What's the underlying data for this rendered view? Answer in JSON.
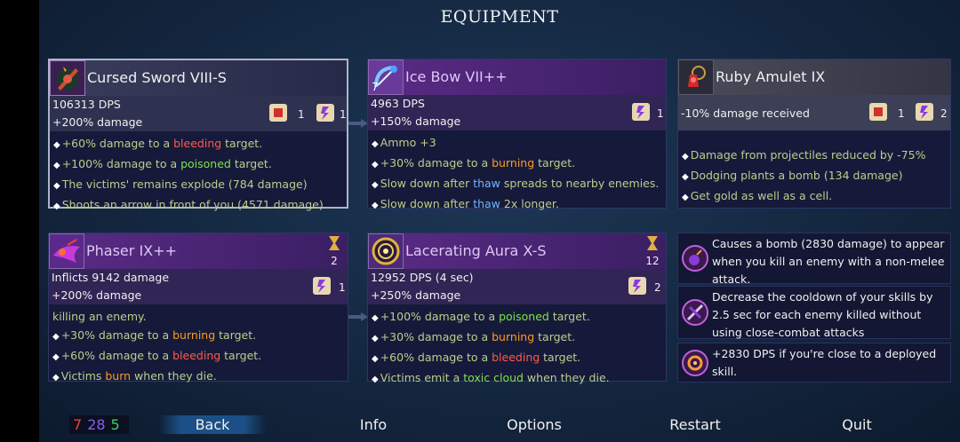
{
  "screen": {
    "title": "EQUIPMENT"
  },
  "cards": {
    "sword": {
      "name": "Cursed Sword VIII-S",
      "stat1": "106313 DPS",
      "stat2": "+200% damage",
      "scroll_a": "1",
      "scroll_b": "1",
      "lines": [
        [
          "+60% damage to a ",
          "bleeding",
          " target."
        ],
        [
          "+100% damage to a ",
          "poisoned",
          " target."
        ],
        [
          "The victims' remains explode (784 damage)"
        ],
        [
          "Shoots an arrow in front of you (4571 damage)"
        ]
      ]
    },
    "bow": {
      "name": "Ice Bow VII++",
      "level": "7",
      "stat1": "4963 DPS",
      "stat2": "+150% damage",
      "scroll_b": "1",
      "l1": "Ammo +3",
      "l2": [
        "+30% damage to a ",
        "burning",
        " target."
      ],
      "l3": [
        "Slow down after ",
        "thaw",
        " spreads to nearby enemies."
      ],
      "l4": [
        "Slow down after ",
        "thaw",
        " 2x longer."
      ]
    },
    "amulet": {
      "name": "Ruby Amulet IX",
      "stat": "-10% damage received",
      "scroll_a": "1",
      "scroll_b": "2",
      "l1": "Damage from projectiles reduced by -75%",
      "l2": "Dodging plants a bomb (134 damage)",
      "l3": "Get gold as well as a cell."
    },
    "phaser": {
      "name": "Phaser IX++",
      "timer": "2",
      "stat1": "Inflicts 9142 damage",
      "stat2": "+200% damage",
      "scroll_b": "1",
      "l1": "killing an enemy.",
      "l2": [
        "+30% damage to a ",
        "burning",
        " target."
      ],
      "l3": [
        "+60% damage to a ",
        "bleeding",
        " target."
      ],
      "l4": [
        "Victims ",
        "burn",
        " when they die."
      ]
    },
    "aura": {
      "name": "Lacerating Aura X-S",
      "timer": "12",
      "stat1": "12952 DPS (4 sec)",
      "stat2": "+250% damage",
      "scroll_b": "2",
      "l1": [
        "+100% damage to a ",
        "poisoned",
        " target."
      ],
      "l2": [
        "+30% damage to a ",
        "burning",
        " target."
      ],
      "l3": [
        "+60% damage to a ",
        "bleeding",
        " target."
      ],
      "l4": [
        "Victims emit a ",
        "toxic cloud",
        " when they die."
      ]
    }
  },
  "mutations": [
    "Causes a bomb (2830 damage) to appear when you kill an enemy with a non-melee attack.",
    "Decrease the cooldown of your skills by 2.5 sec for each enemy killed without using close-combat attacks",
    "+2830 DPS if you're close to a deployed skill."
  ],
  "bullet": "◆",
  "stats": {
    "brutality": "7",
    "tactics": "28",
    "survival": "5"
  },
  "menu": {
    "back": "Back",
    "info": "Info",
    "options": "Options",
    "restart": "Restart",
    "quit": "Quit"
  },
  "colors": {
    "brutality": "#e8453c",
    "tactics": "#8a5cf0",
    "survival": "#3fcf5a",
    "burning": "#ff9a1f",
    "bleeding": "#ff5a4a",
    "poisoned": "#7fe24a",
    "thaw": "#6fb6ff"
  }
}
